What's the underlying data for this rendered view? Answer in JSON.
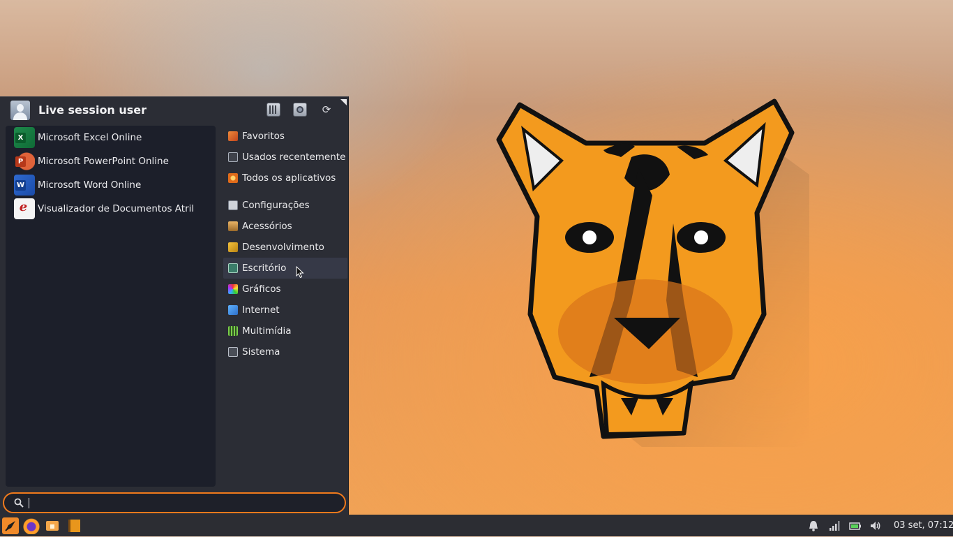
{
  "menu": {
    "user_name": "Live session user",
    "header_buttons": [
      "settings-manager",
      "lock-screen",
      "log-out"
    ],
    "applications": [
      {
        "label": "Microsoft Excel Online",
        "icon": "excel-icon",
        "letter": "X"
      },
      {
        "label": "Microsoft PowerPoint Online",
        "icon": "powerpoint-icon",
        "letter": "P"
      },
      {
        "label": "Microsoft Word Online",
        "icon": "word-icon",
        "letter": "W"
      },
      {
        "label": "Visualizador de Documentos Atril",
        "icon": "atril-icon",
        "letter": "e"
      }
    ],
    "categories": [
      {
        "label": "Favoritos",
        "icon": "favorites-icon"
      },
      {
        "label": "Usados recentemente",
        "icon": "recent-icon"
      },
      {
        "label": "Todos os aplicativos",
        "icon": "all-apps-icon"
      },
      {
        "label": "Configurações",
        "icon": "settings-icon"
      },
      {
        "label": "Acessórios",
        "icon": "accessories-icon"
      },
      {
        "label": "Desenvolvimento",
        "icon": "development-icon"
      },
      {
        "label": "Escritório",
        "icon": "office-icon"
      },
      {
        "label": "Gráficos",
        "icon": "graphics-icon"
      },
      {
        "label": "Internet",
        "icon": "internet-icon"
      },
      {
        "label": "Multimídia",
        "icon": "multimedia-icon"
      },
      {
        "label": "Sistema",
        "icon": "system-icon"
      }
    ],
    "hovered_category": "Escritório",
    "search": {
      "value": "",
      "placeholder": ""
    }
  },
  "taskbar": {
    "launchers": [
      "whisker-menu-icon",
      "firefox-icon",
      "file-manager-icon",
      "book-icon"
    ],
    "tray": [
      "notifications-icon",
      "network-signal-icon",
      "battery-icon",
      "volume-icon"
    ],
    "clock": "03 set, 07:12"
  },
  "colors": {
    "accent": "#f07a1c",
    "menu_bg": "#2b2d35",
    "apps_pane_bg": "#1c1f2a",
    "taskbar_bg": "#2c2d33"
  }
}
